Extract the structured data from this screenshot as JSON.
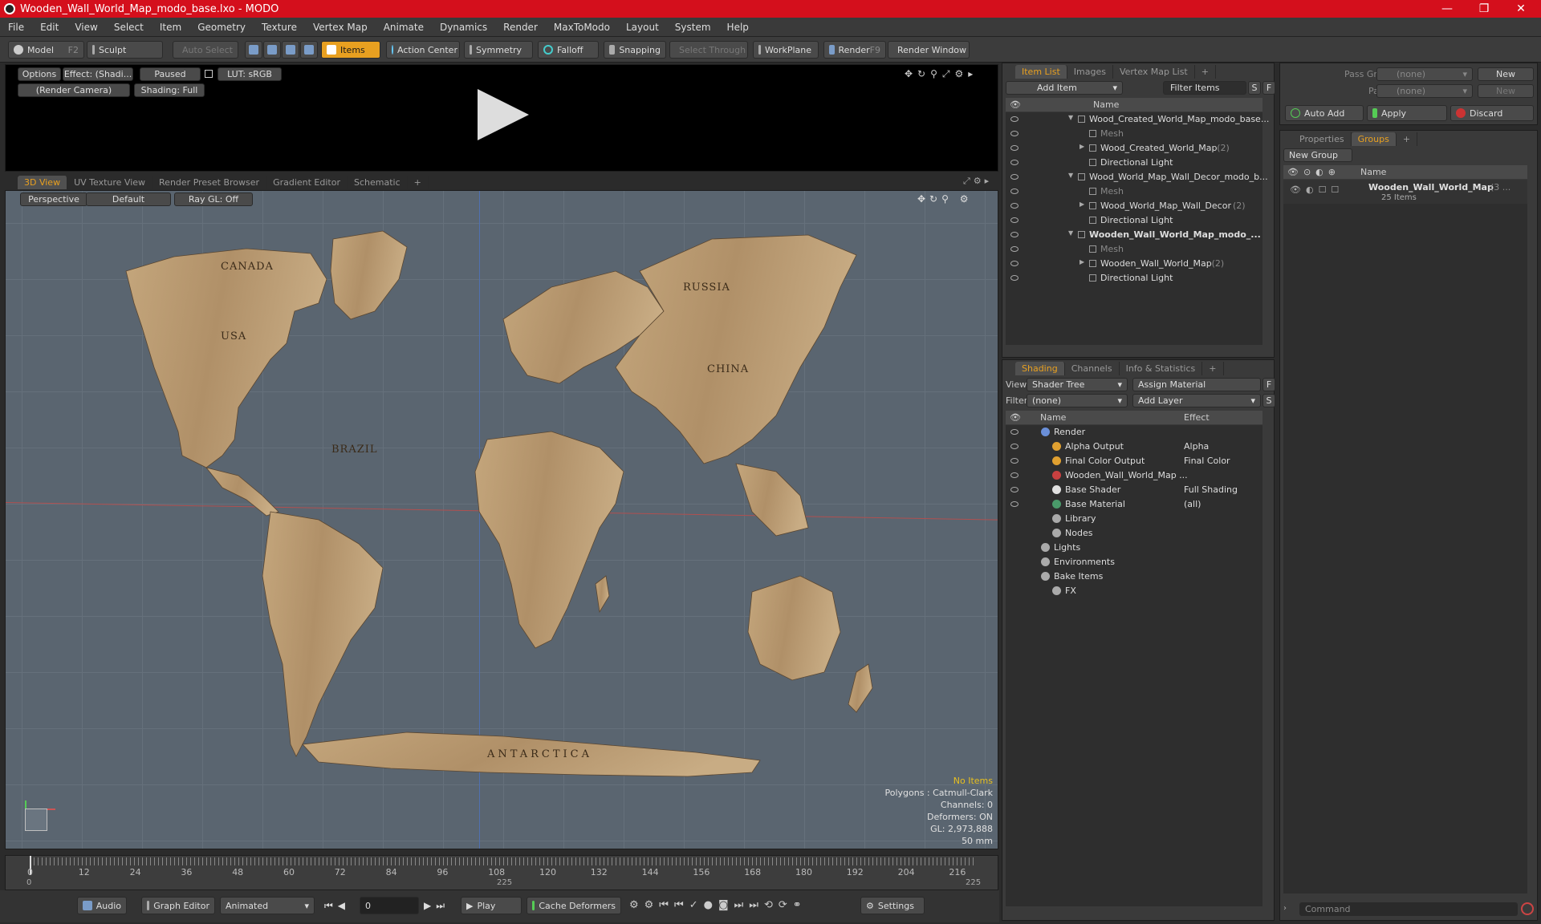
{
  "window": {
    "title": "Wooden_Wall_World_Map_modo_base.lxo - MODO",
    "min": "—",
    "max": "❐",
    "close": "✕"
  },
  "menu": [
    "File",
    "Edit",
    "View",
    "Select",
    "Item",
    "Geometry",
    "Texture",
    "Vertex Map",
    "Animate",
    "Dynamics",
    "Render",
    "MaxToModo",
    "Layout",
    "System",
    "Help"
  ],
  "toolbar": {
    "model": "Model",
    "model_key": "F2",
    "sculpt": "Sculpt",
    "auto_select": "Auto Select",
    "items": "Items",
    "action_center": "Action Center",
    "symmetry": "Symmetry",
    "falloff": "Falloff",
    "snapping": "Snapping",
    "select_through": "Select Through",
    "workplane": "WorkPlane",
    "render": "Render",
    "render_key": "F9",
    "render_window": "Render Window"
  },
  "preview": {
    "options": "Options",
    "effect": "Effect: (Shadi...",
    "paused": "Paused",
    "lut": "LUT: sRGB",
    "camera": "(Render Camera)",
    "shading": "Shading: Full"
  },
  "viewtabs": [
    "3D View",
    "UV Texture View",
    "Render Preset Browser",
    "Gradient Editor",
    "Schematic",
    "+"
  ],
  "viewport": {
    "perspective": "Perspective",
    "default": "Default",
    "raygl": "Ray GL: Off",
    "labels": {
      "canada": "CANADA",
      "usa": "USA",
      "russia": "RUSSIA",
      "china": "CHINA",
      "brazil": "BRAZIL",
      "antarctica": "ANTARCTICA"
    },
    "stats": {
      "no_items": "No Items",
      "polygons": "Polygons : Catmull-Clark",
      "channels": "Channels: 0",
      "deformers": "Deformers: ON",
      "gl": "GL: 2,973,888",
      "mm": "50 mm"
    }
  },
  "timeline": {
    "ticks": [
      "0",
      "12",
      "24",
      "36",
      "48",
      "60",
      "72",
      "84",
      "96",
      "108",
      "120",
      "132",
      "144",
      "156",
      "168",
      "180",
      "192",
      "204",
      "216"
    ],
    "start": "0",
    "mid": "225",
    "end": "225"
  },
  "bottom": {
    "audio": "Audio",
    "graph_editor": "Graph Editor",
    "animated": "Animated",
    "frame": "0",
    "play": "Play",
    "cache": "Cache Deformers",
    "settings": "Settings"
  },
  "itemlist": {
    "tabs": [
      "Item List",
      "Images",
      "Vertex Map List",
      "+"
    ],
    "add_item": "Add Item",
    "filter": "Filter Items",
    "s": "S",
    "f": "F",
    "name_col": "Name",
    "rows": [
      {
        "label": "Wood_Created_World_Map_modo_base...",
        "indent": 0,
        "bold": false,
        "arrow": "▼",
        "muted": false
      },
      {
        "label": "Mesh",
        "indent": 1,
        "bold": false,
        "arrow": "",
        "muted": true
      },
      {
        "label": "Wood_Created_World_Map",
        "count": "(2)",
        "indent": 1,
        "bold": false,
        "arrow": "▶",
        "muted": false
      },
      {
        "label": "Directional Light",
        "indent": 1,
        "bold": false,
        "arrow": "",
        "muted": false
      },
      {
        "label": "Wood_World_Map_Wall_Decor_modo_b...",
        "indent": 0,
        "bold": false,
        "arrow": "▼",
        "muted": false
      },
      {
        "label": "Mesh",
        "indent": 1,
        "bold": false,
        "arrow": "",
        "muted": true
      },
      {
        "label": "Wood_World_Map_Wall_Decor",
        "count": "(2)",
        "indent": 1,
        "bold": false,
        "arrow": "▶",
        "muted": false
      },
      {
        "label": "Directional Light",
        "indent": 1,
        "bold": false,
        "arrow": "",
        "muted": false
      },
      {
        "label": "Wooden_Wall_World_Map_modo_...",
        "indent": 0,
        "bold": true,
        "arrow": "▼",
        "muted": false
      },
      {
        "label": "Mesh",
        "indent": 1,
        "bold": false,
        "arrow": "",
        "muted": true
      },
      {
        "label": "Wooden_Wall_World_Map",
        "count": "(2)",
        "indent": 1,
        "bold": false,
        "arrow": "▶",
        "muted": false
      },
      {
        "label": "Directional Light",
        "indent": 1,
        "bold": false,
        "arrow": "",
        "muted": false
      }
    ]
  },
  "shading": {
    "tabs": [
      "Shading",
      "Channels",
      "Info & Statistics",
      "+"
    ],
    "view_label": "View",
    "view_val": "Shader Tree",
    "assign": "Assign Material",
    "f": "F",
    "filter_label": "Filter",
    "filter_val": "(none)",
    "add_layer": "Add Layer",
    "s": "S",
    "name_col": "Name",
    "effect_col": "Effect",
    "rows": [
      {
        "label": "Render",
        "effect": "",
        "indent": 0
      },
      {
        "label": "Alpha Output",
        "effect": "Alpha",
        "indent": 1
      },
      {
        "label": "Final Color Output",
        "effect": "Final Color",
        "indent": 1
      },
      {
        "label": "Wooden_Wall_World_Map ...",
        "effect": "",
        "indent": 1
      },
      {
        "label": "Base Shader",
        "effect": "Full Shading",
        "indent": 1
      },
      {
        "label": "Base Material",
        "effect": "(all)",
        "indent": 1
      },
      {
        "label": "Library",
        "effect": "",
        "indent": 1
      },
      {
        "label": "Nodes",
        "effect": "",
        "indent": 1
      },
      {
        "label": "Lights",
        "effect": "",
        "indent": 0
      },
      {
        "label": "Environments",
        "effect": "",
        "indent": 0
      },
      {
        "label": "Bake Items",
        "effect": "",
        "indent": 0
      },
      {
        "label": "FX",
        "effect": "",
        "indent": 1
      }
    ]
  },
  "passes": {
    "pass_groups": "Pass Groups",
    "none1": "(none)",
    "new1": "New",
    "passes": "Passes",
    "none2": "(none)",
    "new2": "New",
    "auto_add": "Auto Add",
    "apply": "Apply",
    "discard": "Discard"
  },
  "groups": {
    "tabs": [
      "Properties",
      "Groups",
      "+"
    ],
    "new_group": "New Group",
    "name_col": "Name",
    "item": "Wooden_Wall_World_Map",
    "item_suffix": "(3 ...",
    "items_count": "25 Items"
  },
  "command": {
    "placeholder": "Command"
  },
  "colors": {
    "accent": "#e8a020",
    "title": "#d40f1c",
    "wood": "#b89a72"
  }
}
